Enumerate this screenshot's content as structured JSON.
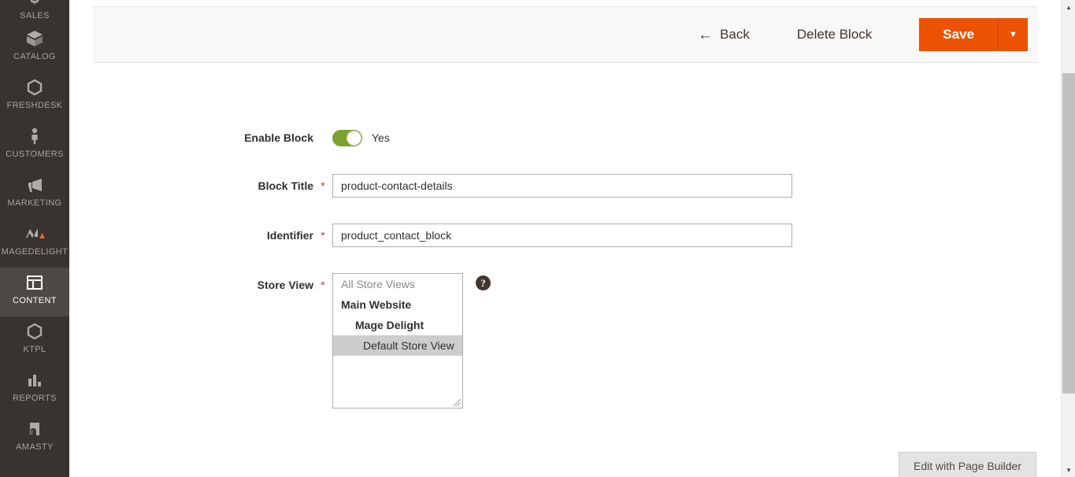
{
  "sidebar": {
    "items": [
      {
        "label": "SALES",
        "icon": "dollar-icon",
        "active": false
      },
      {
        "label": "CATALOG",
        "icon": "box-icon",
        "active": false
      },
      {
        "label": "FRESHDESK",
        "icon": "hexagon-icon",
        "active": false
      },
      {
        "label": "CUSTOMERS",
        "icon": "person-icon",
        "active": false
      },
      {
        "label": "MARKETING",
        "icon": "megaphone-icon",
        "active": false
      },
      {
        "label": "MAGEDELIGHT",
        "icon": "magedelight-icon",
        "active": false
      },
      {
        "label": "CONTENT",
        "icon": "layout-icon",
        "active": true
      },
      {
        "label": "KTPL",
        "icon": "hexagon-icon",
        "active": false
      },
      {
        "label": "REPORTS",
        "icon": "bar-chart-icon",
        "active": false
      },
      {
        "label": "AMASTY",
        "icon": "amasty-icon",
        "active": false
      }
    ]
  },
  "toolbar": {
    "back_label": "Back",
    "back_icon": "arrow-left-icon",
    "delete_label": "Delete Block",
    "save_label": "Save",
    "save_toggle_icon": "chevron-down-icon"
  },
  "form": {
    "enable_block": {
      "label": "Enable Block",
      "toggle_state": "on",
      "toggle_text": "Yes"
    },
    "block_title": {
      "label": "Block Title",
      "required": "*",
      "value": "product-contact-details",
      "placeholder": ""
    },
    "identifier": {
      "label": "Identifier",
      "required": "*",
      "value": "product_contact_block",
      "placeholder": ""
    },
    "store_view": {
      "label": "Store View",
      "required": "*",
      "help_icon": "question-mark-icon",
      "options": [
        {
          "label": "All Store Views",
          "level": 0,
          "selected": false
        },
        {
          "label": "Main Website",
          "level": 1,
          "selected": false
        },
        {
          "label": "Mage Delight",
          "level": 2,
          "selected": false
        },
        {
          "label": "Default Store View",
          "level": 3,
          "selected": true
        }
      ]
    }
  },
  "page_builder": {
    "label": "Edit with Page Builder"
  },
  "scrollbar": {
    "up_icon": "caret-up-icon",
    "down_icon": "caret-down-icon"
  },
  "colors": {
    "accent_orange": "#eb5202",
    "toggle_green": "#79a22e",
    "sidebar_bg": "#373330",
    "required_red": "#e02b27"
  }
}
